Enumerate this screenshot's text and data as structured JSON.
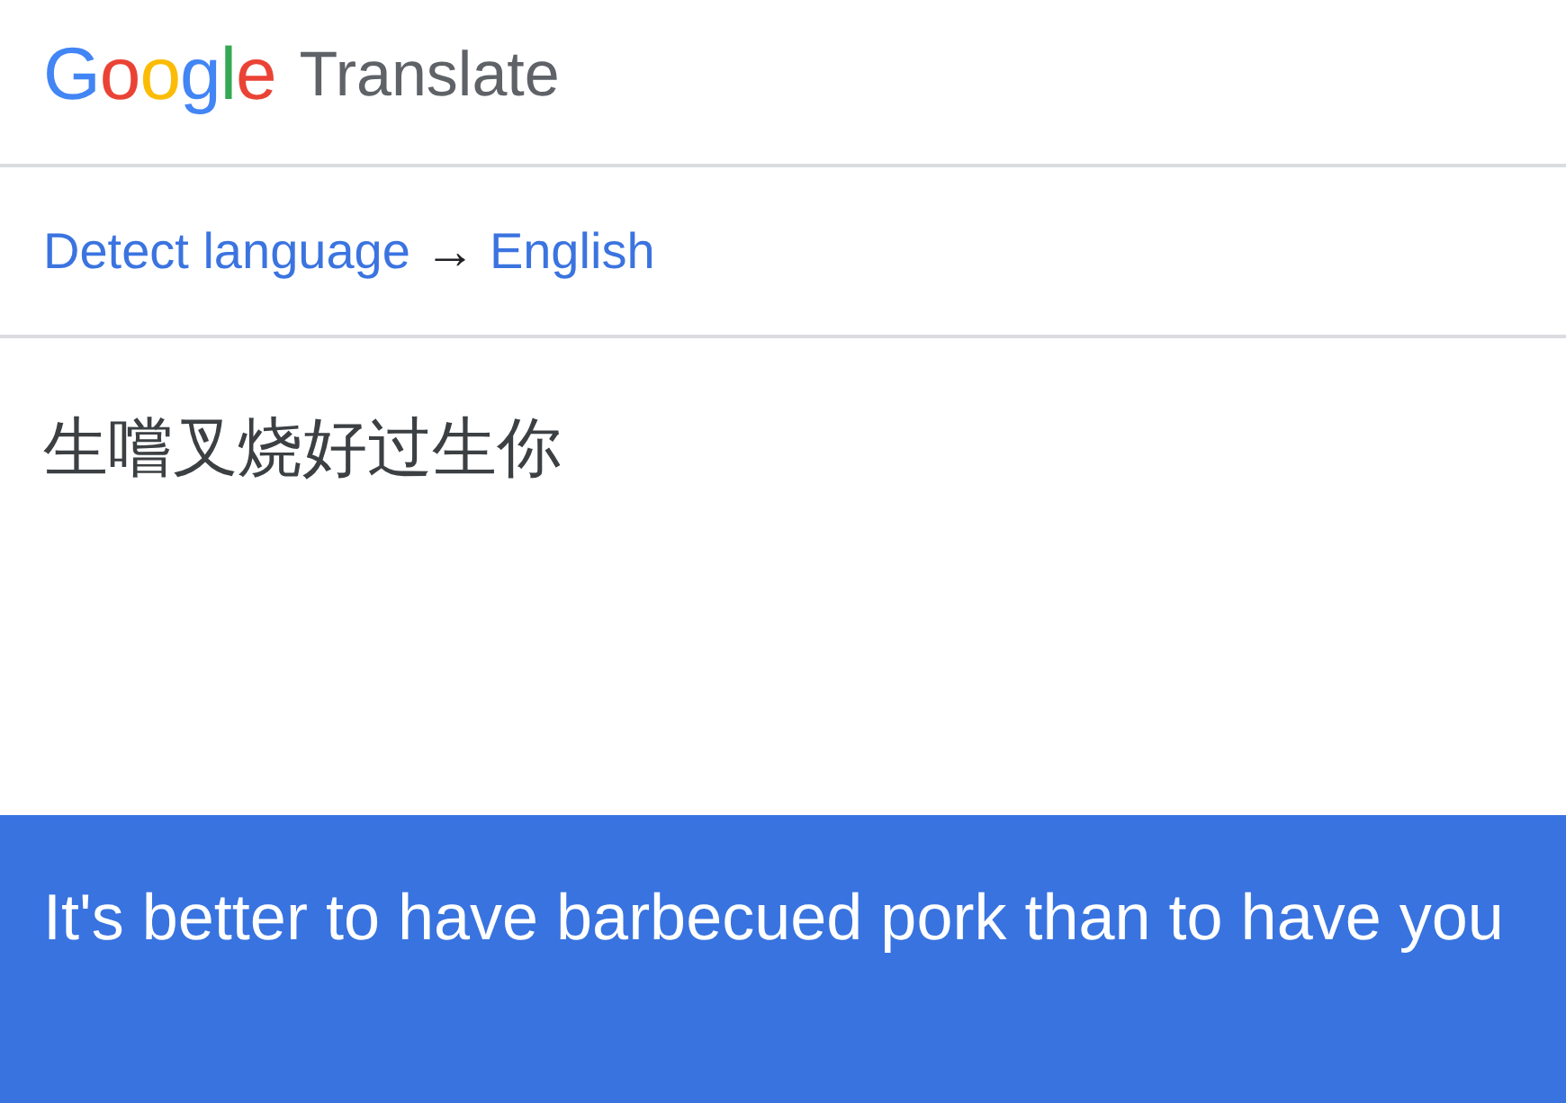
{
  "header": {
    "logo": "Google",
    "title": "Translate"
  },
  "language_bar": {
    "source": "Detect language",
    "arrow": "→",
    "target": "English"
  },
  "input": {
    "value": "生嚐叉烧好过生你"
  },
  "output": {
    "text": "It's better to have barbecued pork than to have you"
  }
}
